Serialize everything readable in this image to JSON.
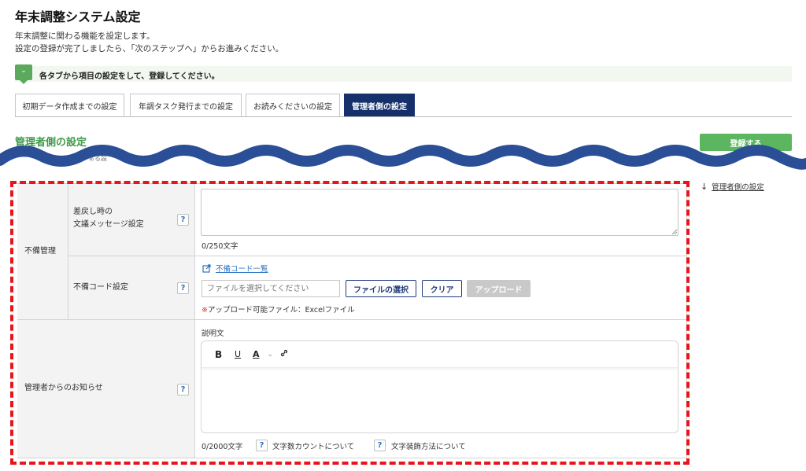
{
  "page": {
    "title": "年末調整システム設定",
    "desc_line1": "年末調整に関わる機能を設定します。",
    "desc_line2": "設定の登録が完了しましたら、「次のステップへ」からお進みください。"
  },
  "notice": {
    "icon": "chevron-down-icon",
    "text": "各タブから項目の設定をして、登録してください。"
  },
  "tabs": [
    {
      "label": "初期データ作成までの設定",
      "active": false
    },
    {
      "label": "年調タスク発行までの設定",
      "active": false
    },
    {
      "label": "お読みくださいの設定",
      "active": false
    },
    {
      "label": "管理者側の設定",
      "active": true
    }
  ],
  "section": {
    "title": "管理者側の設定",
    "register_label": "登録する",
    "partial_text": "ぁる設"
  },
  "side_nav": {
    "link_label": "管理者側の設定"
  },
  "form": {
    "group_label": "不備管理",
    "row1": {
      "label_line1": "差戻し時の",
      "label_line2": "文議メッセージ設定",
      "help": "?",
      "count": "0/250文字"
    },
    "row2": {
      "label": "不備コード設定",
      "help": "?",
      "link_label": "不備コード一覧",
      "file_placeholder": "ファイルを選択してください",
      "select_button": "ファイルの選択",
      "clear_button": "クリア",
      "upload_button": "アップロード",
      "note_mark": "※",
      "note_text": "アップロード可能ファイル：Excelファイル"
    },
    "row3": {
      "label": "管理者からのお知らせ",
      "help": "?",
      "editor_label": "説明文",
      "toolbar": {
        "bold": "B",
        "underline": "U",
        "color": "A"
      },
      "count": "0/2000文字",
      "help_count_text": "文字数カウントについて",
      "help_deco_text": "文字装飾方法について"
    }
  },
  "colors": {
    "accent_green": "#5cb660",
    "section_green": "#3f9a4a",
    "active_tab": "#15306b",
    "wave_blue": "#2b4f96",
    "dashed_red": "#e8141b",
    "link_blue": "#2f74c0"
  }
}
